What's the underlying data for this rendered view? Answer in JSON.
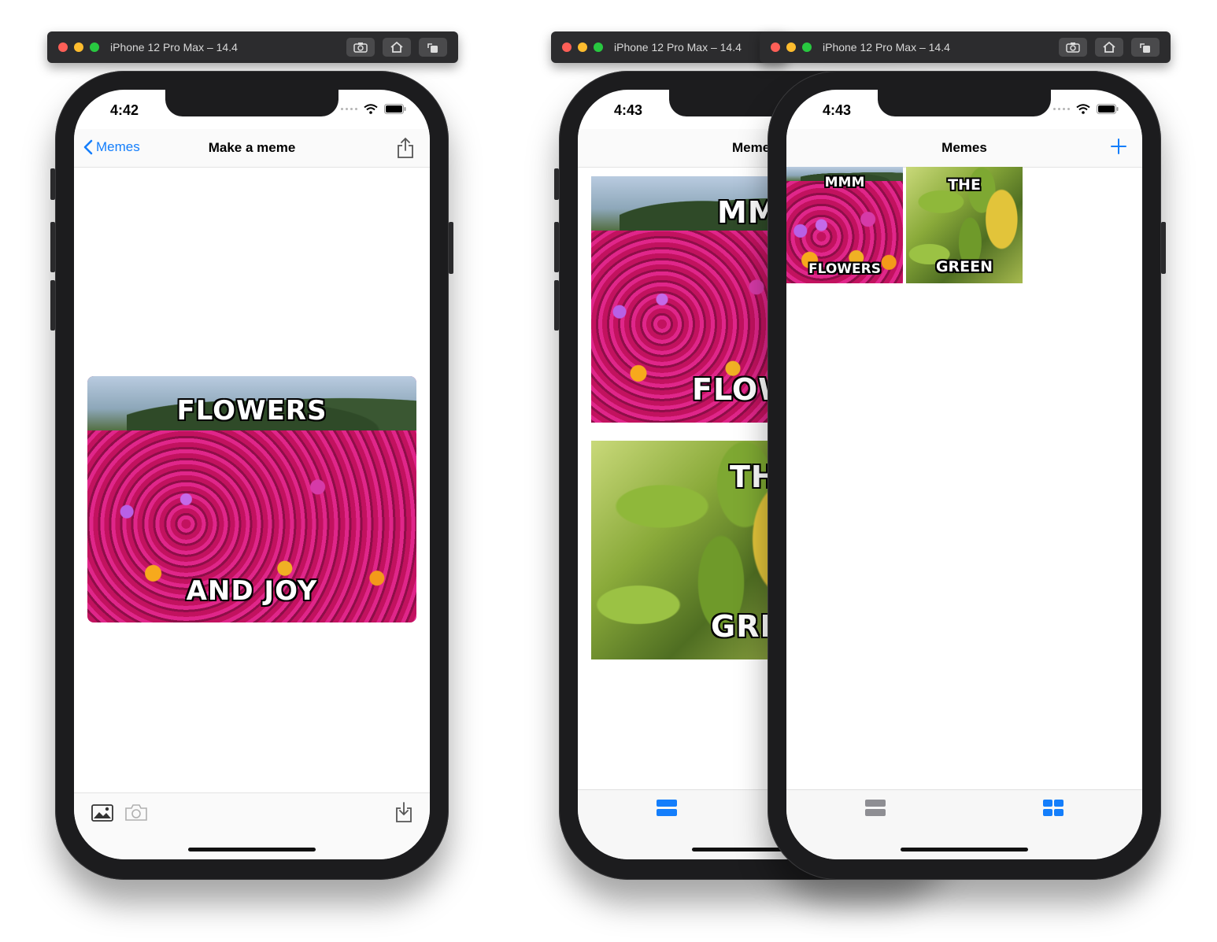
{
  "simulators": [
    {
      "title": "iPhone 12 Pro Max – 14.4"
    },
    {
      "title": "iPhone 12 Pro Max – 14.4"
    },
    {
      "title": "iPhone 12 Pro Max – 14.4"
    }
  ],
  "phone1": {
    "time": "4:42",
    "nav": {
      "back_label": "Memes",
      "title": "Make a meme"
    },
    "meme": {
      "top": "FLOWERS",
      "bottom": "AND JOY"
    }
  },
  "phone2": {
    "time": "4:43",
    "nav": {
      "title": "Meme"
    },
    "memes": [
      {
        "top": "MM",
        "bottom": "FLOW"
      },
      {
        "top": "TH",
        "bottom": "GRE"
      }
    ]
  },
  "phone3": {
    "time": "4:43",
    "nav": {
      "title": "Memes"
    },
    "memes": [
      {
        "top": "MMM",
        "bottom": "FLOWERS"
      },
      {
        "top": "THE",
        "bottom": "GREEN"
      }
    ]
  },
  "colors": {
    "accent": "#147efb",
    "tab_inactive": "#8e8e93"
  }
}
